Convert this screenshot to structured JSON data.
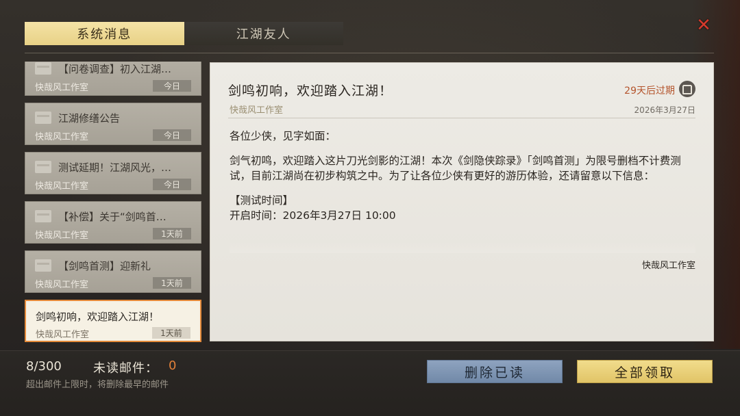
{
  "tabs": [
    {
      "label": "系统消息",
      "active": true
    },
    {
      "label": "江湖友人",
      "active": false
    }
  ],
  "close_icon": "close-icon",
  "mail_list": [
    {
      "title": "【问卷调查】初入江湖…",
      "sender": "快哉风工作室",
      "time": "今日"
    },
    {
      "title": "江湖修缮公告",
      "sender": "快哉风工作室",
      "time": "今日"
    },
    {
      "title": "测试延期！江湖风光，…",
      "sender": "快哉风工作室",
      "time": "今日"
    },
    {
      "title": "【补偿】关于“剑鸣首…",
      "sender": "快哉风工作室",
      "time": "1天前"
    },
    {
      "title": "【剑鸣首测】迎新礼",
      "sender": "快哉风工作室",
      "time": "1天前"
    },
    {
      "title": "剑鸣初响，欢迎踏入江湖！",
      "sender": "快哉风工作室",
      "time": "1天前",
      "selected": true
    }
  ],
  "detail": {
    "title": "剑鸣初响，欢迎踏入江湖！",
    "sender": "快哉风工作室",
    "expire": "29天后过期",
    "date": "2026年3月27日",
    "body": [
      "各位少侠，见字如面：",
      "剑气初鸣，欢迎踏入这片刀光剑影的江湖！本次《剑隐侠踪录》「剑鸣首测」为限号删档不计费测试，目前江湖尚在初步构筑之中。为了让各位少侠有更好的游历体验，还请留意以下信息：",
      "【测试时间】",
      "开启时间：2026年3月27日 10:00"
    ],
    "signature": "快哉风工作室"
  },
  "footer": {
    "count": "8/300",
    "unread_label": "未读邮件：",
    "unread_count": "0",
    "limit_note": "超出邮件上限时，将删除最早的邮件",
    "delete_label": "删除已读",
    "claim_label": "全部领取"
  },
  "colors": {
    "tab_active": "#f0dd9c",
    "expire_text": "#b4542c",
    "selected_border": "#e58a3a",
    "close_x": "#d63a2c",
    "delete_button": "#7f96b4",
    "claim_button": "#e9d07a"
  }
}
